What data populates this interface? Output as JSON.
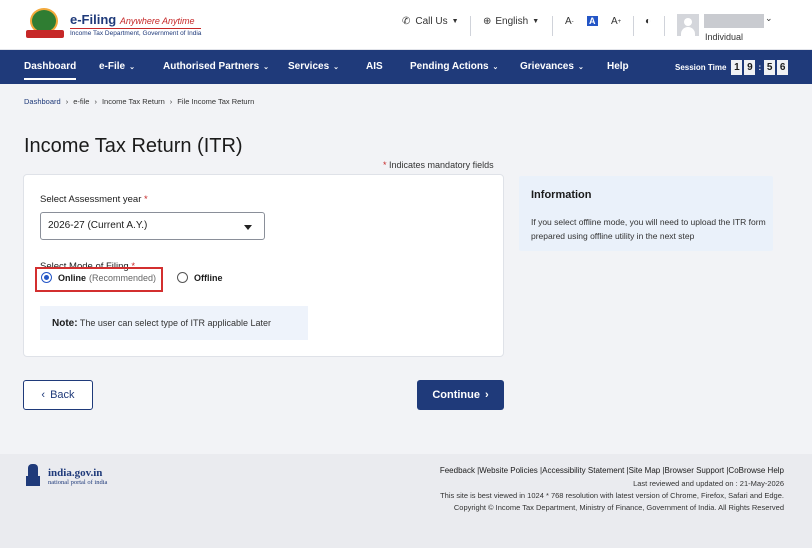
{
  "header": {
    "logo_title": "e-Filing",
    "logo_tagline": "Anywhere Anytime",
    "logo_subtitle": "Income Tax Department, Government of India",
    "call_us": "Call Us",
    "language": "English",
    "text_smaller": "A",
    "text_normal": "A",
    "text_larger": "A",
    "user_type": "Individual"
  },
  "nav": {
    "items": [
      {
        "label": "Dashboard"
      },
      {
        "label": "e-File"
      },
      {
        "label": "Authorised Partners"
      },
      {
        "label": "Services"
      },
      {
        "label": "AIS"
      },
      {
        "label": "Pending Actions"
      },
      {
        "label": "Grievances"
      },
      {
        "label": "Help"
      }
    ],
    "session_label": "Session Time",
    "timer": [
      "1",
      "9",
      "5",
      "6"
    ]
  },
  "breadcrumb": [
    "Dashboard",
    "e-file",
    "Income Tax Return",
    "File Income Tax Return"
  ],
  "page_title": "Income Tax Return (ITR)",
  "mandatory_note": "Indicates mandatory fields",
  "form": {
    "assessment_year_label": "Select Assessment year",
    "assessment_year_value": "2026-27  (Current A.Y.)",
    "mode_label": "Select Mode of Filing",
    "online_label": "Online",
    "online_hint": "(Recommended)",
    "offline_label": "Offline",
    "selected_mode": "Online",
    "note_label": "Note:",
    "note_text": "The user can select type of ITR applicable Later"
  },
  "info": {
    "title": "Information",
    "text": "If you select offline mode, you will need to upload the ITR form prepared using offline utility in the next step"
  },
  "buttons": {
    "back": "Back",
    "continue": "Continue"
  },
  "footer": {
    "india_title": "india.gov.in",
    "india_subtitle": "national portal of india",
    "links": "Feedback |Website Policies |Accessibility Statement |Site Map |Browser Support |CoBrowse Help",
    "last_reviewed": "Last reviewed and updated on : 21-May-2026",
    "best_viewed": "This site is best viewed in 1024 * 768 resolution with latest version of Chrome, Firefox, Safari and Edge.",
    "copyright": "Copyright © Income Tax Department, Ministry of Finance, Government of India. All Rights Reserved"
  },
  "colors": {
    "primary": "#1f3a7a",
    "highlight": "#d32f2f",
    "info_bg": "#eaf1fa"
  }
}
